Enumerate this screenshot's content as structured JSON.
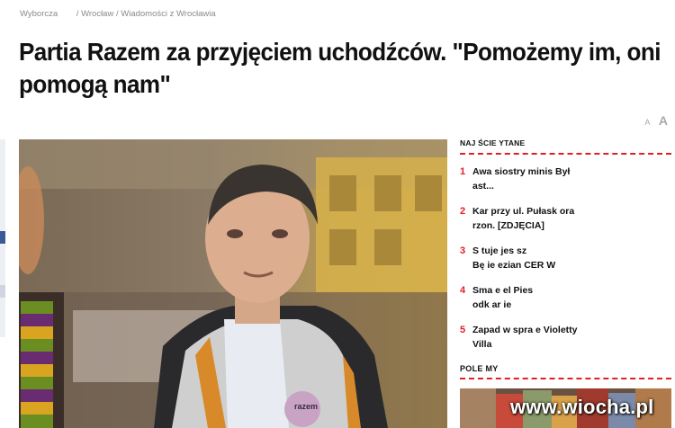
{
  "breadcrumb": {
    "site": "Wyborcza",
    "section": "/ Wrocław / Wiadomości z Wrocławia"
  },
  "article": {
    "title_line1": "Partia Razem za przyjęciem uchodźców. \"Pomożemy im, oni",
    "title_line2": "pomogą nam\"",
    "font_small": "A",
    "font_big": "A",
    "badge_text": "razem"
  },
  "sidebar": {
    "most_read_title": "NAJ  ŚCIE    YTANE",
    "items": [
      {
        "num": "1",
        "line1": "Awa    siostry minis    Był",
        "line2": "            ast..."
      },
      {
        "num": "2",
        "line1": "Kar        przy ul. Pułask        ora",
        "line2": "   rzon. [ZDJĘCIA]"
      },
      {
        "num": "3",
        "line1": "S   tuje jes          sz",
        "line2": "Bę  ie   ezian     CER   W"
      },
      {
        "num": "4",
        "line1": "Sma               e   el     Pies",
        "line2": "odk   ar      ie"
      },
      {
        "num": "5",
        "line1": "Zapad     w spra   e     Violetty",
        "line2": "Villa"
      }
    ],
    "popular_title": "POLE   MY"
  },
  "watermark": "www.wiocha.pl",
  "colors": {
    "accent": "#e21f26",
    "text": "#111111",
    "muted": "#8a8a8a"
  }
}
